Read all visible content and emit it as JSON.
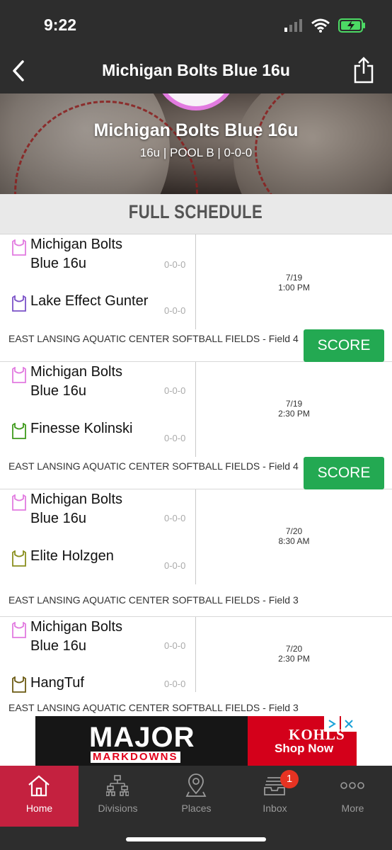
{
  "status": {
    "time": "9:22"
  },
  "nav": {
    "title": "Michigan Bolts Blue 16u"
  },
  "hero": {
    "team_name": "Michigan Bolts Blue 16u",
    "subtitle": "16u | POOL B | 0-0-0"
  },
  "schedule": {
    "header": "FULL SCHEDULE",
    "games": [
      {
        "team1": {
          "name": "Michigan Bolts Blue 16u",
          "record": "0-0-0",
          "color": "#e27be0"
        },
        "team2": {
          "name": "Lake Effect Gunter",
          "record": "0-0-0",
          "color": "#7b52c8"
        },
        "date": "7/19",
        "time": "1:00 PM",
        "venue": "EAST LANSING AQUATIC CENTER SOFTBALL FIELDS - Field 4",
        "score_label": "SCORE"
      },
      {
        "team1": {
          "name": "Michigan Bolts Blue 16u",
          "record": "0-0-0",
          "color": "#e27be0"
        },
        "team2": {
          "name": "Finesse Kolinski",
          "record": "0-0-0",
          "color": "#3f9a1c"
        },
        "date": "7/19",
        "time": "2:30 PM",
        "venue": "EAST LANSING AQUATIC CENTER SOFTBALL FIELDS - Field 4",
        "score_label": "SCORE"
      },
      {
        "team1": {
          "name": "Michigan Bolts Blue 16u",
          "record": "0-0-0",
          "color": "#e27be0"
        },
        "team2": {
          "name": "Elite Holzgen",
          "record": "0-0-0",
          "color": "#8a8f1e"
        },
        "date": "7/20",
        "time": "8:30 AM",
        "venue": "EAST LANSING AQUATIC CENTER SOFTBALL FIELDS - Field 3"
      },
      {
        "team1": {
          "name": "Michigan Bolts Blue 16u",
          "record": "0-0-0",
          "color": "#e27be0"
        },
        "team2": {
          "name": "HangTuf",
          "record": "0-0-0",
          "color": "#6b5a12"
        },
        "date": "7/20",
        "time": "2:30 PM",
        "venue": "EAST LANSING AQUATIC CENTER SOFTBALL FIELDS - Field 3"
      }
    ]
  },
  "ad": {
    "headline": "MAJOR",
    "subline": "MARKDOWNS",
    "brand": "KOHLS",
    "cta": "Shop Now"
  },
  "tabbar": {
    "tabs": [
      {
        "label": "Home",
        "icon": "home-icon"
      },
      {
        "label": "Divisions",
        "icon": "bracket-icon"
      },
      {
        "label": "Places",
        "icon": "location-pin-icon"
      },
      {
        "label": "Inbox",
        "icon": "inbox-icon",
        "badge": "1"
      },
      {
        "label": "More",
        "icon": "more-dots-icon"
      }
    ]
  },
  "colors": {
    "accent": "#c4213f",
    "score_button": "#23a952",
    "bar": "#2d2d2d"
  }
}
